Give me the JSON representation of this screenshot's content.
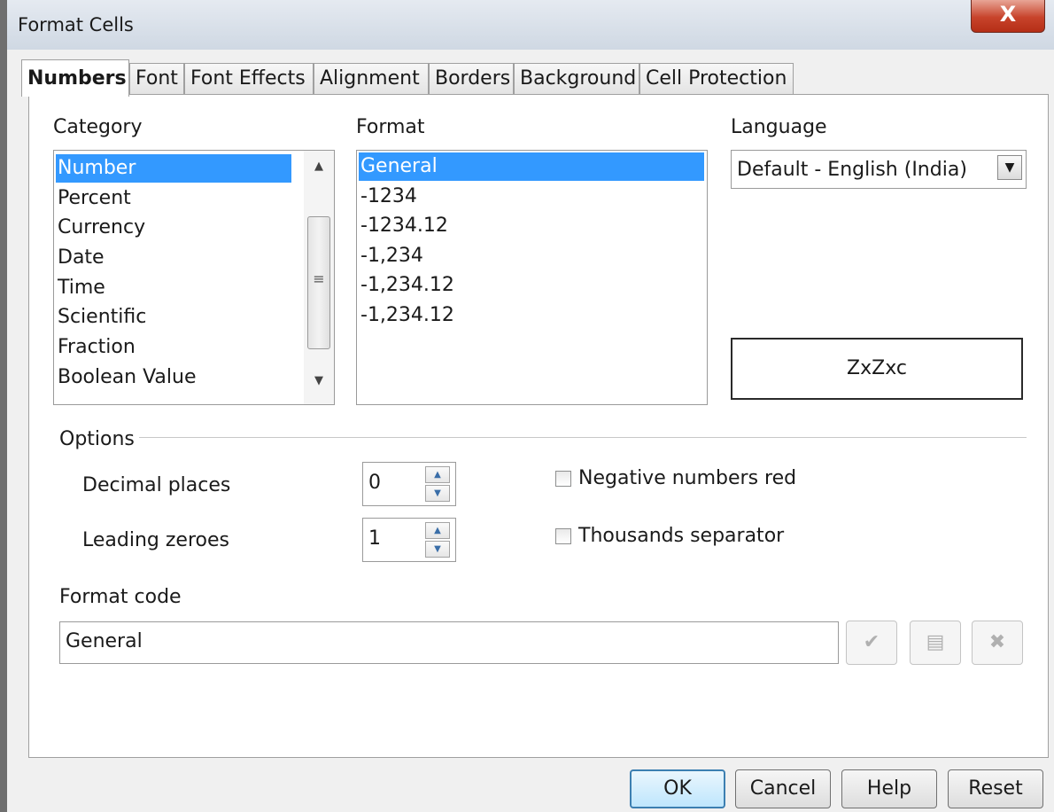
{
  "window": {
    "title": "Format Cells",
    "close_glyph": "X"
  },
  "tabs": [
    "Numbers",
    "Font",
    "Font Effects",
    "Alignment",
    "Borders",
    "Background",
    "Cell Protection"
  ],
  "category": {
    "label": "Category",
    "items": [
      "Number",
      "Percent",
      "Currency",
      "Date",
      "Time",
      "Scientific",
      "Fraction",
      "Boolean Value"
    ],
    "selected": "Number"
  },
  "format": {
    "label": "Format",
    "items": [
      "General",
      "-1234",
      "-1234.12",
      "-1,234",
      "-1,234.12",
      "-1,234.12"
    ],
    "selected": "General"
  },
  "language": {
    "label": "Language",
    "value": "Default - English (India)"
  },
  "preview": {
    "text": "ZxZxc"
  },
  "options": {
    "label": "Options",
    "decimal_places_label": "Decimal places",
    "decimal_places_value": "0",
    "leading_zeroes_label": "Leading zeroes",
    "leading_zeroes_value": "1",
    "negative_red_label": "Negative numbers red",
    "negative_red_checked": false,
    "thousands_label": "Thousands separator",
    "thousands_checked": false
  },
  "format_code": {
    "label": "Format code",
    "value": "General"
  },
  "buttons": {
    "ok": "OK",
    "cancel": "Cancel",
    "help": "Help",
    "reset": "Reset"
  },
  "icons": {
    "close": "close-icon",
    "apply": "checkmark-icon",
    "comment": "edit-comment-icon",
    "delete": "delete-icon"
  }
}
